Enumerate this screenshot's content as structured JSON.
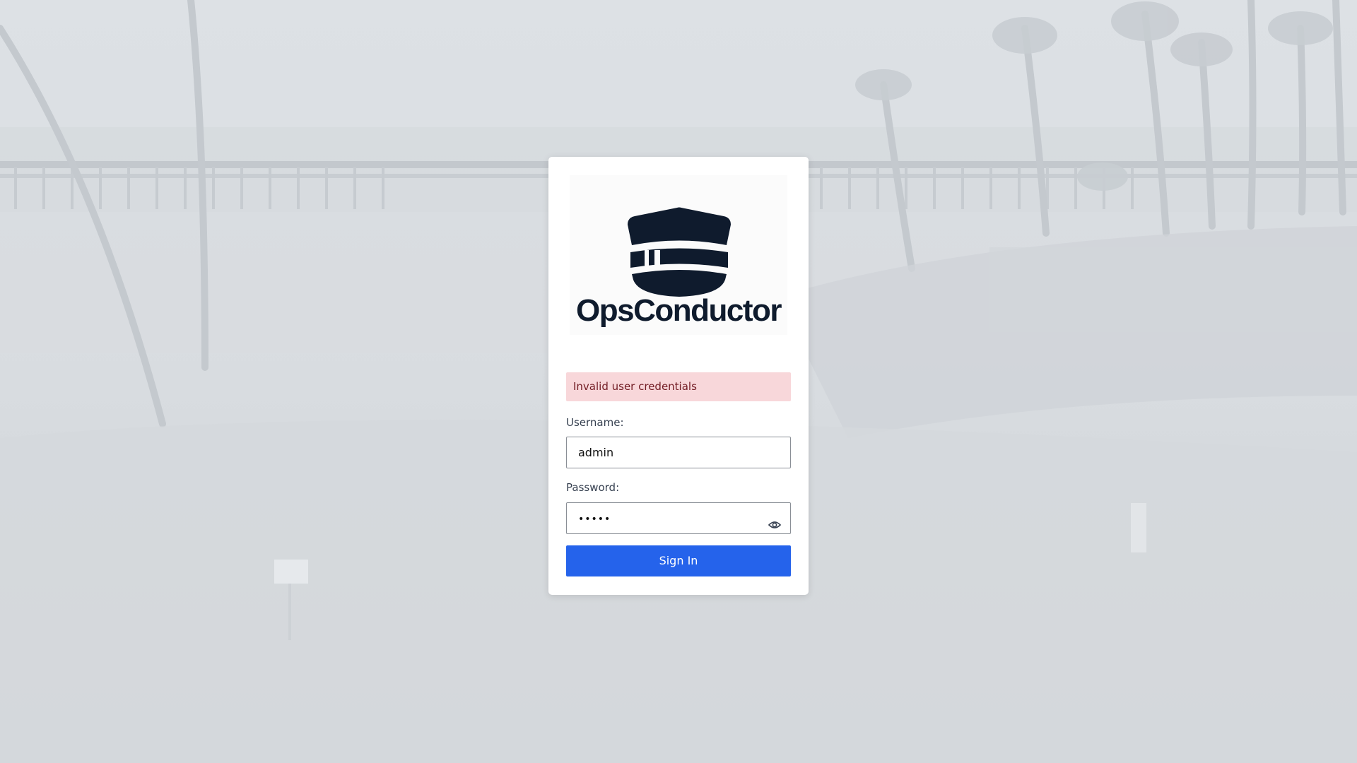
{
  "brand": {
    "name": "OpsConductor",
    "logo_icon": "conductor-cap-icon",
    "logo_color": "#0f1b2d"
  },
  "alert": {
    "message": "Invalid user credentials",
    "background": "#f8d7da",
    "text_color": "#721c24"
  },
  "form": {
    "username_label": "Username:",
    "username_value": "admin",
    "password_label": "Password:",
    "password_value": "•••••",
    "password_toggle_icon": "eye-icon",
    "submit_label": "Sign In",
    "submit_color": "#2563eb"
  }
}
